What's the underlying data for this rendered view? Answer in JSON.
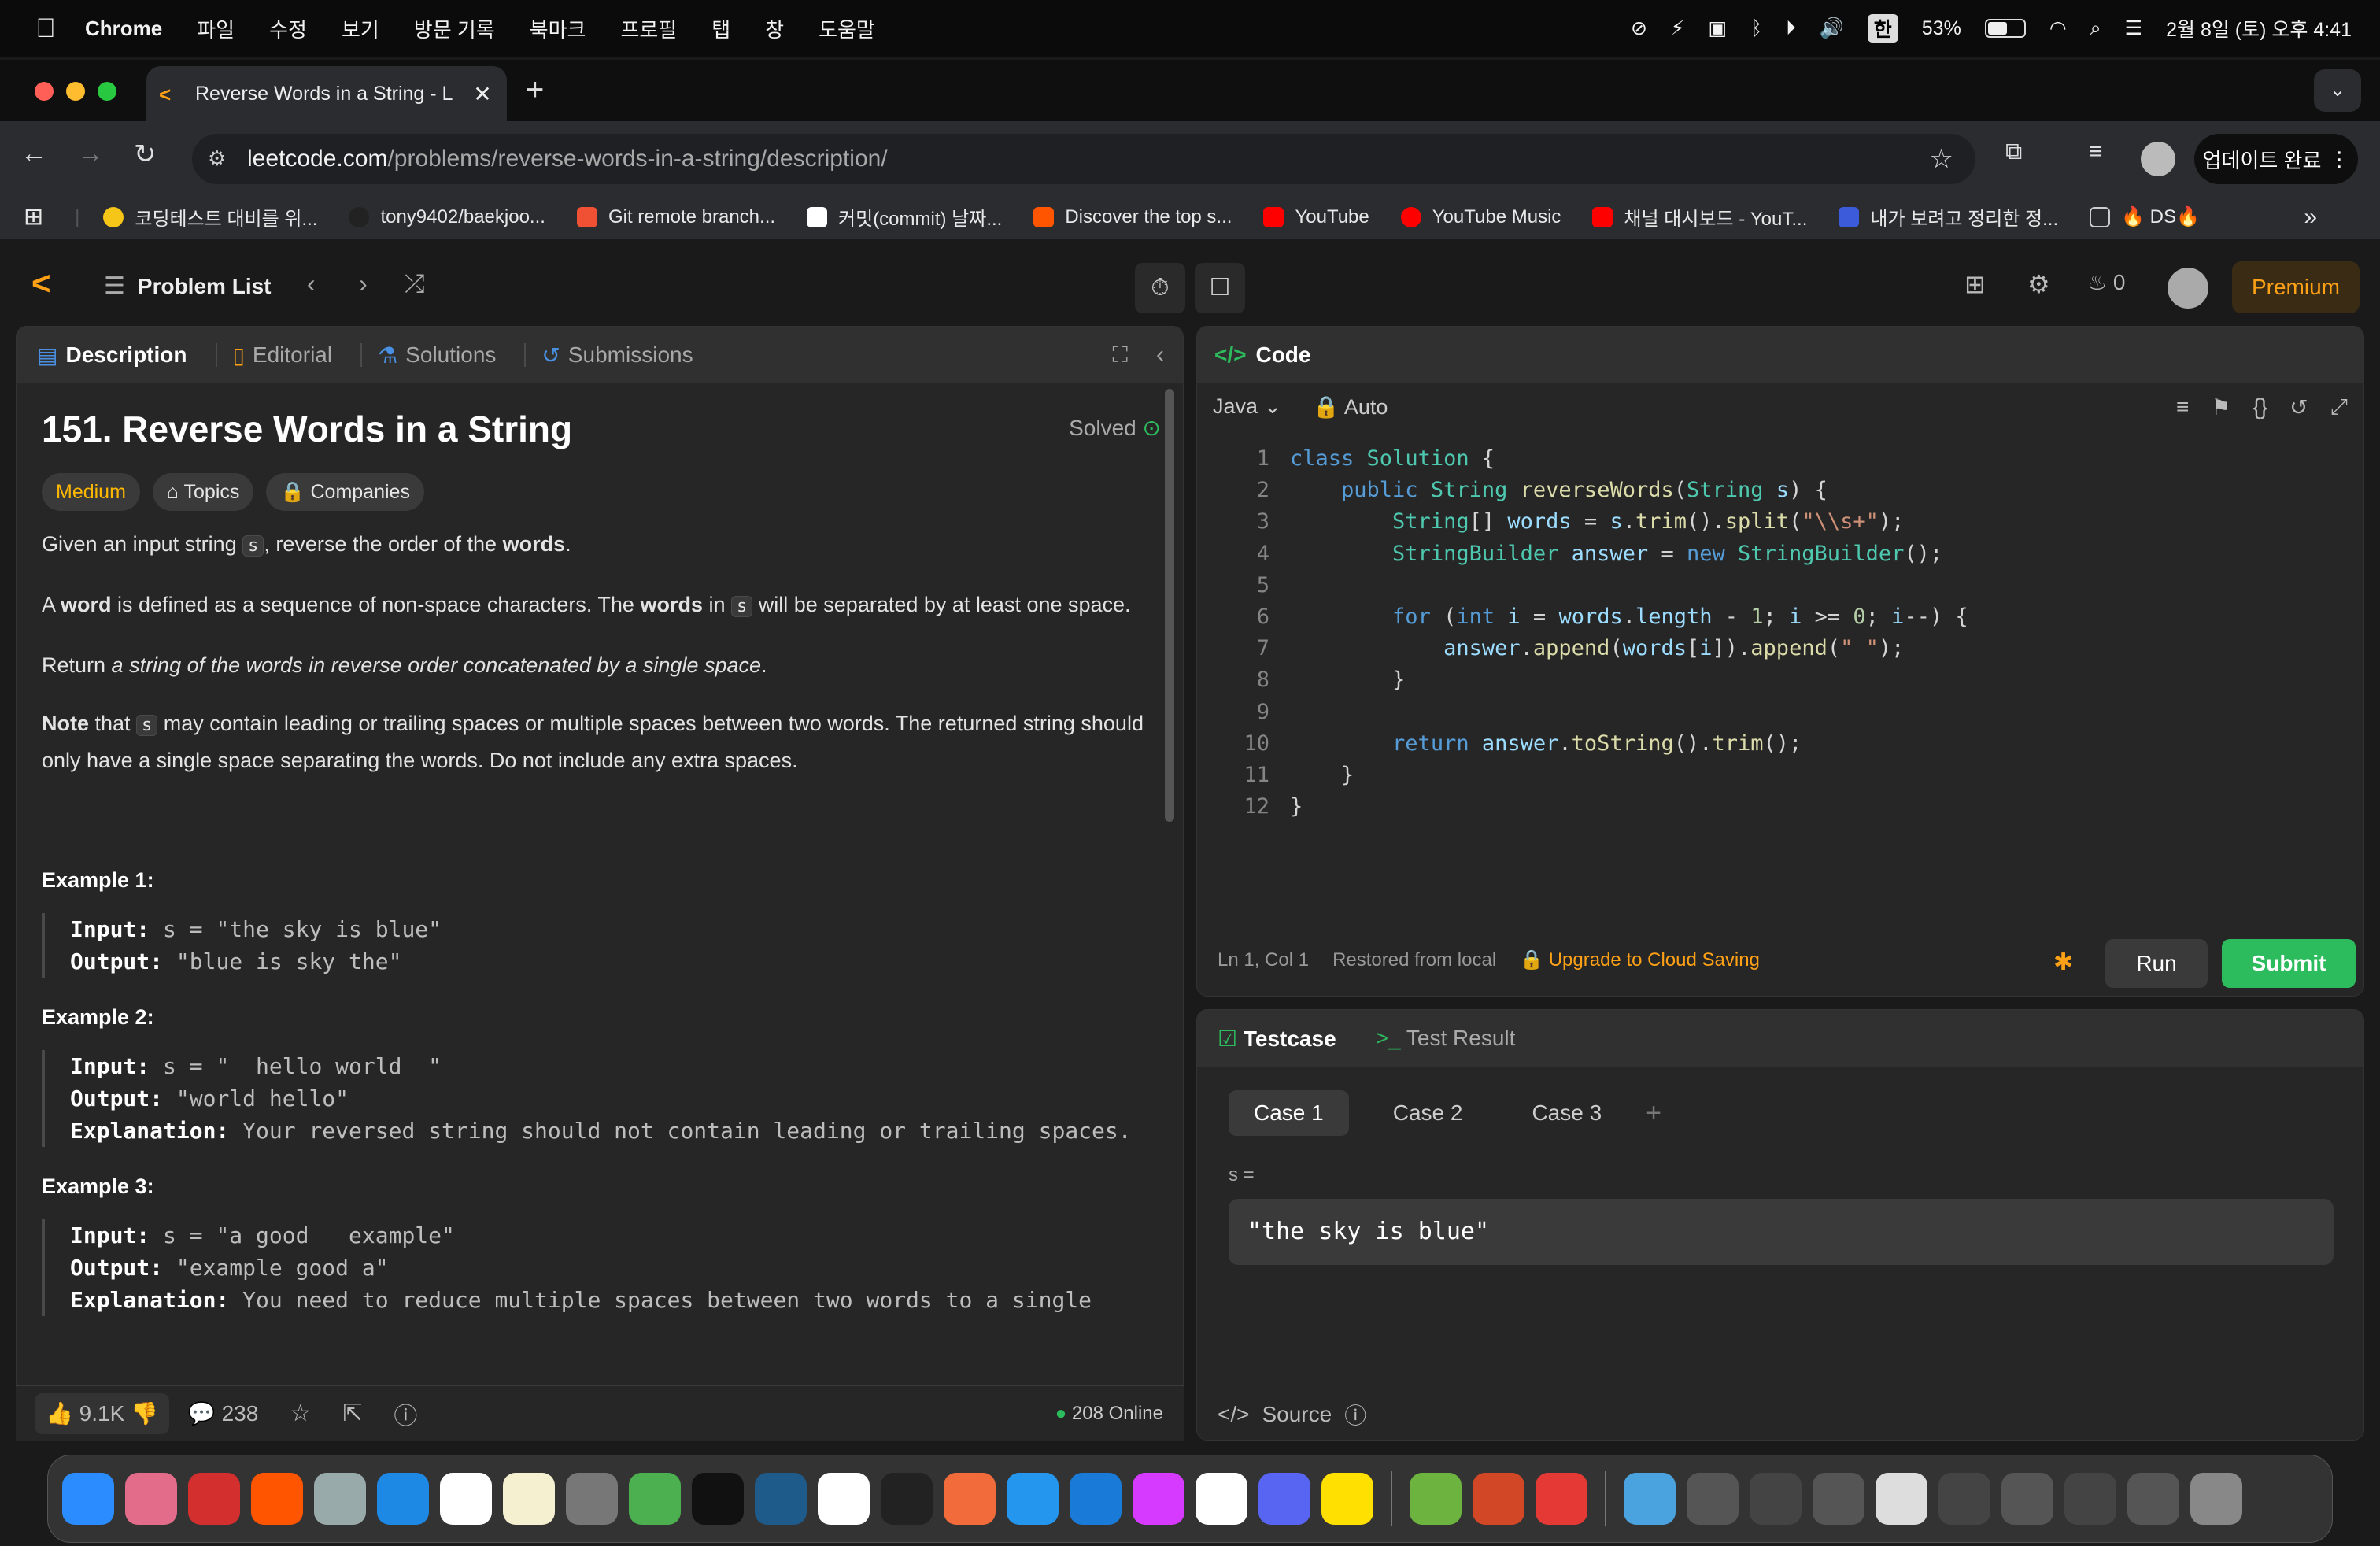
{
  "menubar": {
    "items": [
      "Chrome",
      "파일",
      "수정",
      "보기",
      "방문 기록",
      "북마크",
      "프로필",
      "탭",
      "창",
      "도움말"
    ],
    "battery": "53%",
    "ime": "한",
    "datetime": "2월 8일 (토) 오후 4:41"
  },
  "browser": {
    "tab_title": "Reverse Words in a String - L",
    "url_host": "leetcode.com",
    "url_path": "/problems/reverse-words-in-a-string/description/",
    "update_label": "업데이트 완료",
    "bookmarks": [
      {
        "label": "코딩테스트 대비를 위...",
        "color": "#f5c518"
      },
      {
        "label": "tony9402/baekjoo...",
        "color": "#222222"
      },
      {
        "label": "Git remote branch...",
        "color": "#f05033"
      },
      {
        "label": "커밋(commit) 날짜...",
        "color": "#ffffff"
      },
      {
        "label": "Discover the top s...",
        "color": "#ff5500"
      },
      {
        "label": "YouTube",
        "color": "#ff0000"
      },
      {
        "label": "YouTube Music",
        "color": "#ff0000"
      },
      {
        "label": "채널 대시보드 - YouT...",
        "color": "#ff0000"
      },
      {
        "label": "내가 보려고 정리한 정...",
        "color": "#3b5bdb"
      },
      {
        "label": "🔥 DS🔥",
        "color": "#888888"
      }
    ]
  },
  "lc": {
    "problem_list": "Problem List",
    "streak": "0",
    "premium": "Premium"
  },
  "left": {
    "tabs": [
      "Description",
      "Editorial",
      "Solutions",
      "Submissions"
    ],
    "title": "151. Reverse Words in a String",
    "solved": "Solved",
    "difficulty": "Medium",
    "topics": "Topics",
    "companies": "Companies",
    "para1": {
      "a": "Given an input string ",
      "code": "s",
      "b": ", reverse the order of the ",
      "bold": "words",
      "c": "."
    },
    "para2": {
      "a": "A ",
      "bold1": "word",
      "b": " is defined as a sequence of non-space characters. The ",
      "bold2": "words",
      "c": " in ",
      "code": "s",
      "d": " will be separated by at least one space."
    },
    "para3": {
      "a": "Return ",
      "italic": "a string of the words in reverse order concatenated by a single space",
      "b": "."
    },
    "para4": {
      "bold": "Note",
      "a": " that ",
      "code": "s",
      "b": " may contain leading or trailing spaces or multiple spaces between two words. The returned string should only have a single space separating the words. Do not include any extra spaces."
    },
    "examples": [
      {
        "title": "Example 1:",
        "input": "s = \"the sky is blue\"",
        "output": "\"blue is sky the\"",
        "explanation": ""
      },
      {
        "title": "Example 2:",
        "input": "s = \"  hello world  \"",
        "output": "\"world hello\"",
        "explanation": "Your reversed string should not contain leading or trailing spaces."
      },
      {
        "title": "Example 3:",
        "input": "s = \"a good   example\"",
        "output": "\"example good a\"",
        "explanation": "You need to reduce multiple spaces between two words to a single"
      }
    ],
    "labels": {
      "input": "Input:",
      "output": "Output:",
      "explanation": "Explanation:"
    },
    "likes": "9.1K",
    "comments": "238",
    "online": "208 Online"
  },
  "code": {
    "header": "Code",
    "language": "Java",
    "auto": "Auto",
    "status_pos": "Ln 1, Col 1",
    "status_restored": "Restored from local",
    "status_upgrade": "Upgrade to Cloud Saving",
    "run": "Run",
    "submit": "Submit",
    "line_numbers": [
      "1",
      "2",
      "3",
      "4",
      "5",
      "6",
      "7",
      "8",
      "9",
      "10",
      "11",
      "12"
    ]
  },
  "test": {
    "tab_testcase": "Testcase",
    "tab_result": "Test Result",
    "cases": [
      "Case 1",
      "Case 2",
      "Case 3"
    ],
    "var_label": "s =",
    "var_value": "\"the sky is blue\"",
    "source": "Source"
  }
}
